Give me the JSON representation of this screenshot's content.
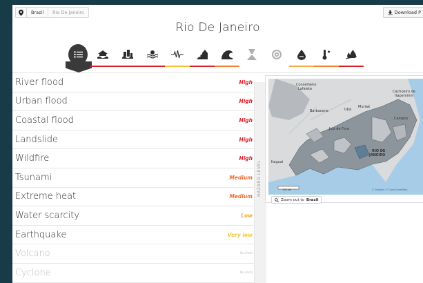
{
  "breadcrumb": {
    "country": "Brazil",
    "location": "Rio De Janeiro"
  },
  "download_label": "Download P",
  "page_title": "Rio De Janeiro",
  "hazard_icons": [
    {
      "name": "list-icon",
      "underline": "",
      "active": true
    },
    {
      "name": "river-flood-icon",
      "underline": "#d8202a"
    },
    {
      "name": "urban-flood-icon",
      "underline": "#d8202a"
    },
    {
      "name": "coastal-flood-icon",
      "underline": "#d8202a"
    },
    {
      "name": "earthquake-icon",
      "underline": "#f2c230"
    },
    {
      "name": "landslide-icon",
      "underline": "#d8202a"
    },
    {
      "name": "tsunami-icon",
      "underline": "#ef7d2b"
    },
    {
      "name": "volcano-icon",
      "underline": ""
    },
    {
      "name": "cyclone-icon",
      "underline": ""
    },
    {
      "name": "water-scarcity-icon",
      "underline": "#f2a93b"
    },
    {
      "name": "extreme-heat-icon",
      "underline": "#ef7d2b"
    },
    {
      "name": "wildfire-icon",
      "underline": "#d8202a"
    }
  ],
  "hazards": [
    {
      "name": "River flood",
      "level": "High",
      "color": "#d8202a"
    },
    {
      "name": "Urban flood",
      "level": "High",
      "color": "#d8202a"
    },
    {
      "name": "Coastal flood",
      "level": "High",
      "color": "#d8202a"
    },
    {
      "name": "Landslide",
      "level": "High",
      "color": "#d8202a"
    },
    {
      "name": "Wildfire",
      "level": "High",
      "color": "#d8202a"
    },
    {
      "name": "Tsunami",
      "level": "Medium",
      "color": "#ef6a2b"
    },
    {
      "name": "Extreme heat",
      "level": "Medium",
      "color": "#ef6a2b"
    },
    {
      "name": "Water scarcity",
      "level": "Low",
      "color": "#f2a93b"
    },
    {
      "name": "Earthquake",
      "level": "Very low",
      "color": "#f5c83a"
    },
    {
      "name": "Volcano",
      "level": "No Data",
      "color": "#c0c0c0",
      "nodata": true
    },
    {
      "name": "Cyclone",
      "level": "No Data",
      "color": "#c0c0c0",
      "nodata": true
    }
  ],
  "hazard_level_label": "HAZARD LEVEL",
  "map": {
    "labels": {
      "conselheiro": "Conselheiro",
      "lafaiete": "Lafaiete",
      "cachoeiro": "Cachoeiro de",
      "itapemirim": "Itapemirim",
      "barbacena": "Barbacena",
      "ubá": "Ubá",
      "muriae": "Muriaé",
      "juiz_de_fora": "Juiz de Fora",
      "rio": "RIO DE",
      "janeiro": "JANEIRO",
      "campos": "Campos",
      "itaguaia": "Itaguaí",
      "scale": "100 km",
      "attribution": "© Mapbox © OpenStreetMap"
    },
    "zoom_prefix": "Zoom out to",
    "zoom_target": "Brazil"
  }
}
